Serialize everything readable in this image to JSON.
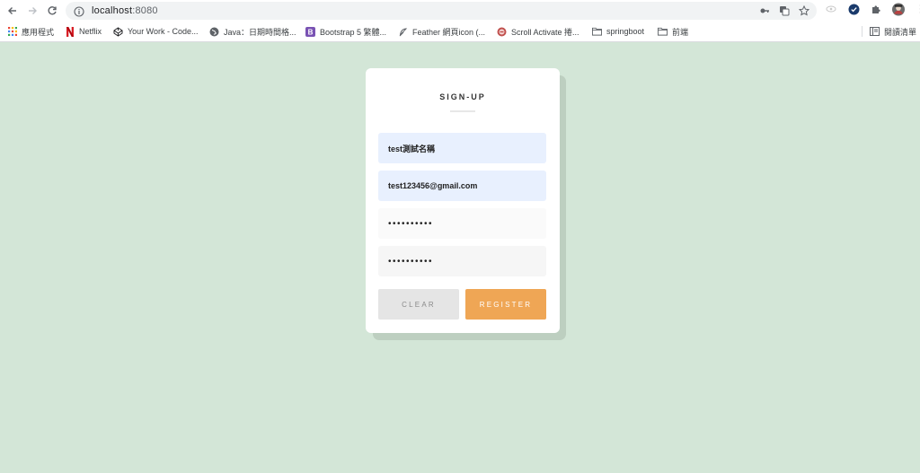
{
  "browser": {
    "url_host": "localhost",
    "url_port": ":8080",
    "bookmarks": [
      {
        "label": "應用程式",
        "icon": "apps-grid-icon"
      },
      {
        "label": "Netflix",
        "icon": "netflix-icon"
      },
      {
        "label": "Your Work - Code...",
        "icon": "codepen-icon"
      },
      {
        "label": "Java：日期時間格...",
        "icon": "globe-icon"
      },
      {
        "label": "Bootstrap 5 繁體...",
        "icon": "bootstrap-icon"
      },
      {
        "label": "Feather 網頁icon (...",
        "icon": "feather-icon"
      },
      {
        "label": "Scroll Activate 捲...",
        "icon": "scroll-icon"
      },
      {
        "label": "springboot",
        "icon": "folder-icon"
      },
      {
        "label": "前端",
        "icon": "folder-icon"
      }
    ],
    "reading_list": "閱讀清單"
  },
  "signup": {
    "title": "SIGN-UP",
    "name_value": "test測試名稱",
    "email_value": "test123456@gmail.com",
    "password_value": "••••••••••",
    "confirm_value": "••••••••••",
    "clear_label": "CLEAR",
    "register_label": "REGISTER"
  },
  "colors": {
    "background": "#d3e6d7",
    "accent": "#efa655",
    "autofill": "#e8f0fe"
  }
}
